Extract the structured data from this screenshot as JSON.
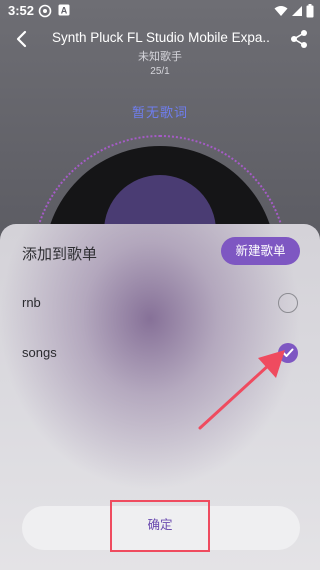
{
  "status_bar": {
    "time": "3:52",
    "icons_left": [
      "sync-icon",
      "a-badge-icon"
    ],
    "icons_right": [
      "wifi-icon",
      "signal-icon",
      "battery-icon"
    ]
  },
  "player": {
    "title": "Synth Pluck FL Studio Mobile Expa..",
    "artist": "未知歌手",
    "count": "25/1",
    "no_lyrics": "暂无歌词"
  },
  "sheet": {
    "title": "添加到歌单",
    "new_playlist_label": "新建歌单",
    "playlists": [
      {
        "name": "rnb",
        "checked": false
      },
      {
        "name": "songs",
        "checked": true
      }
    ],
    "confirm_label": "确定"
  },
  "colors": {
    "accent": "#7e57c2",
    "annotation_red": "#ef4b5f",
    "lyrics_blue": "#6f7ef0",
    "disc_ring": "#a65bc8"
  }
}
